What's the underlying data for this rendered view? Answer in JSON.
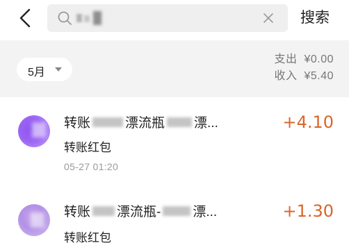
{
  "header": {
    "search_placeholder": "",
    "search_button": "搜索"
  },
  "filter": {
    "month": "5月",
    "expense_label": "支出",
    "expense_value": "¥0.00",
    "income_label": "收入",
    "income_value": "¥5.40"
  },
  "transactions": [
    {
      "title_prefix": "转账",
      "title_middle": "漂流瓶",
      "title_suffix": "漂...",
      "subtitle": "转账红包",
      "time": "05-27  01:20",
      "amount": "+4.10"
    },
    {
      "title_prefix": "转账",
      "title_middle": "漂流瓶-",
      "title_suffix": "漂...",
      "subtitle": "转账红包",
      "amount": "+1.30"
    }
  ],
  "colors": {
    "accent_amount": "#d9662a",
    "filter_background": "#f3f3f3",
    "search_background": "#efefef"
  },
  "icons": {
    "back": "chevron-left-icon",
    "search": "search-icon",
    "clear": "close-icon",
    "month_dropdown": "caret-down-icon"
  }
}
